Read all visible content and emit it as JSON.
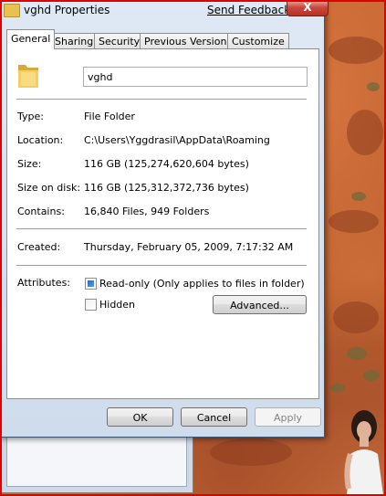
{
  "window": {
    "title": "vghd Properties",
    "feedback_link": "Send Feedback",
    "close_glyph": "X"
  },
  "tabs": [
    {
      "label": "General",
      "active": true
    },
    {
      "label": "Sharing",
      "active": false
    },
    {
      "label": "Security",
      "active": false
    },
    {
      "label": "Previous Versions",
      "active": false
    },
    {
      "label": "Customize",
      "active": false
    }
  ],
  "general": {
    "folder_icon": "folder-icon",
    "name": "vghd",
    "type_label": "Type:",
    "type_value": "File Folder",
    "location_label": "Location:",
    "location_value": "C:\\Users\\Yggdrasil\\AppData\\Roaming",
    "size_label": "Size:",
    "size_value": "116 GB (125,274,620,604 bytes)",
    "size_on_disk_label": "Size on disk:",
    "size_on_disk_value": "116 GB (125,312,372,736 bytes)",
    "contains_label": "Contains:",
    "contains_value": "16,840 Files, 949 Folders",
    "created_label": "Created:",
    "created_value": "Thursday, February 05, 2009, 7:17:32 AM",
    "attributes_label": "Attributes:",
    "readonly_label": "Read-only (Only applies to files in folder)",
    "readonly_state": "indeterminate",
    "hidden_label": "Hidden",
    "hidden_state": "unchecked",
    "advanced_label": "Advanced..."
  },
  "footer": {
    "ok_label": "OK",
    "cancel_label": "Cancel",
    "apply_label": "Apply",
    "apply_enabled": false
  },
  "colors": {
    "titlebar": "#dfe9f5",
    "close_button": "#c7463a",
    "checkbox_fill": "#1f6bbd",
    "desktop": "#b85a2a",
    "screen_frame": "#e00000"
  }
}
